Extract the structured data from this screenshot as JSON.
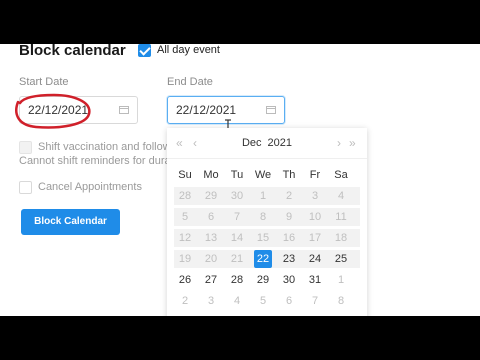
{
  "page": {
    "title": "Block calendar"
  },
  "all_day": {
    "label": "All day event",
    "checked": true
  },
  "start_date": {
    "label": "Start Date",
    "value": "22/12/2021"
  },
  "end_date": {
    "label": "End Date",
    "value": "22/12/2021"
  },
  "shift": {
    "line1": "Shift vaccination and follow u",
    "line2": "Cannot shift reminders for duratio"
  },
  "cancel": {
    "label": "Cancel Appointments",
    "checked": false
  },
  "block_button": {
    "label": "Block Calendar"
  },
  "calendar": {
    "month": "Dec",
    "year": "2021",
    "nav": {
      "prev_year": "«",
      "prev_month": "‹",
      "next_month": "›",
      "next_year": "»"
    },
    "weekdays": [
      "Su",
      "Mo",
      "Tu",
      "We",
      "Th",
      "Fr",
      "Sa"
    ],
    "weeks": [
      [
        "28",
        "29",
        "30",
        "1",
        "2",
        "3",
        "4"
      ],
      [
        "5",
        "6",
        "7",
        "8",
        "9",
        "10",
        "11"
      ],
      [
        "12",
        "13",
        "14",
        "15",
        "16",
        "17",
        "18"
      ],
      [
        "19",
        "20",
        "21",
        "22",
        "23",
        "24",
        "25"
      ],
      [
        "26",
        "27",
        "28",
        "29",
        "30",
        "31",
        "1"
      ],
      [
        "2",
        "3",
        "4",
        "5",
        "6",
        "7",
        "8"
      ]
    ],
    "selected": "22"
  },
  "colors": {
    "accent": "#1f8ce8",
    "annotation": "#d0202a"
  }
}
